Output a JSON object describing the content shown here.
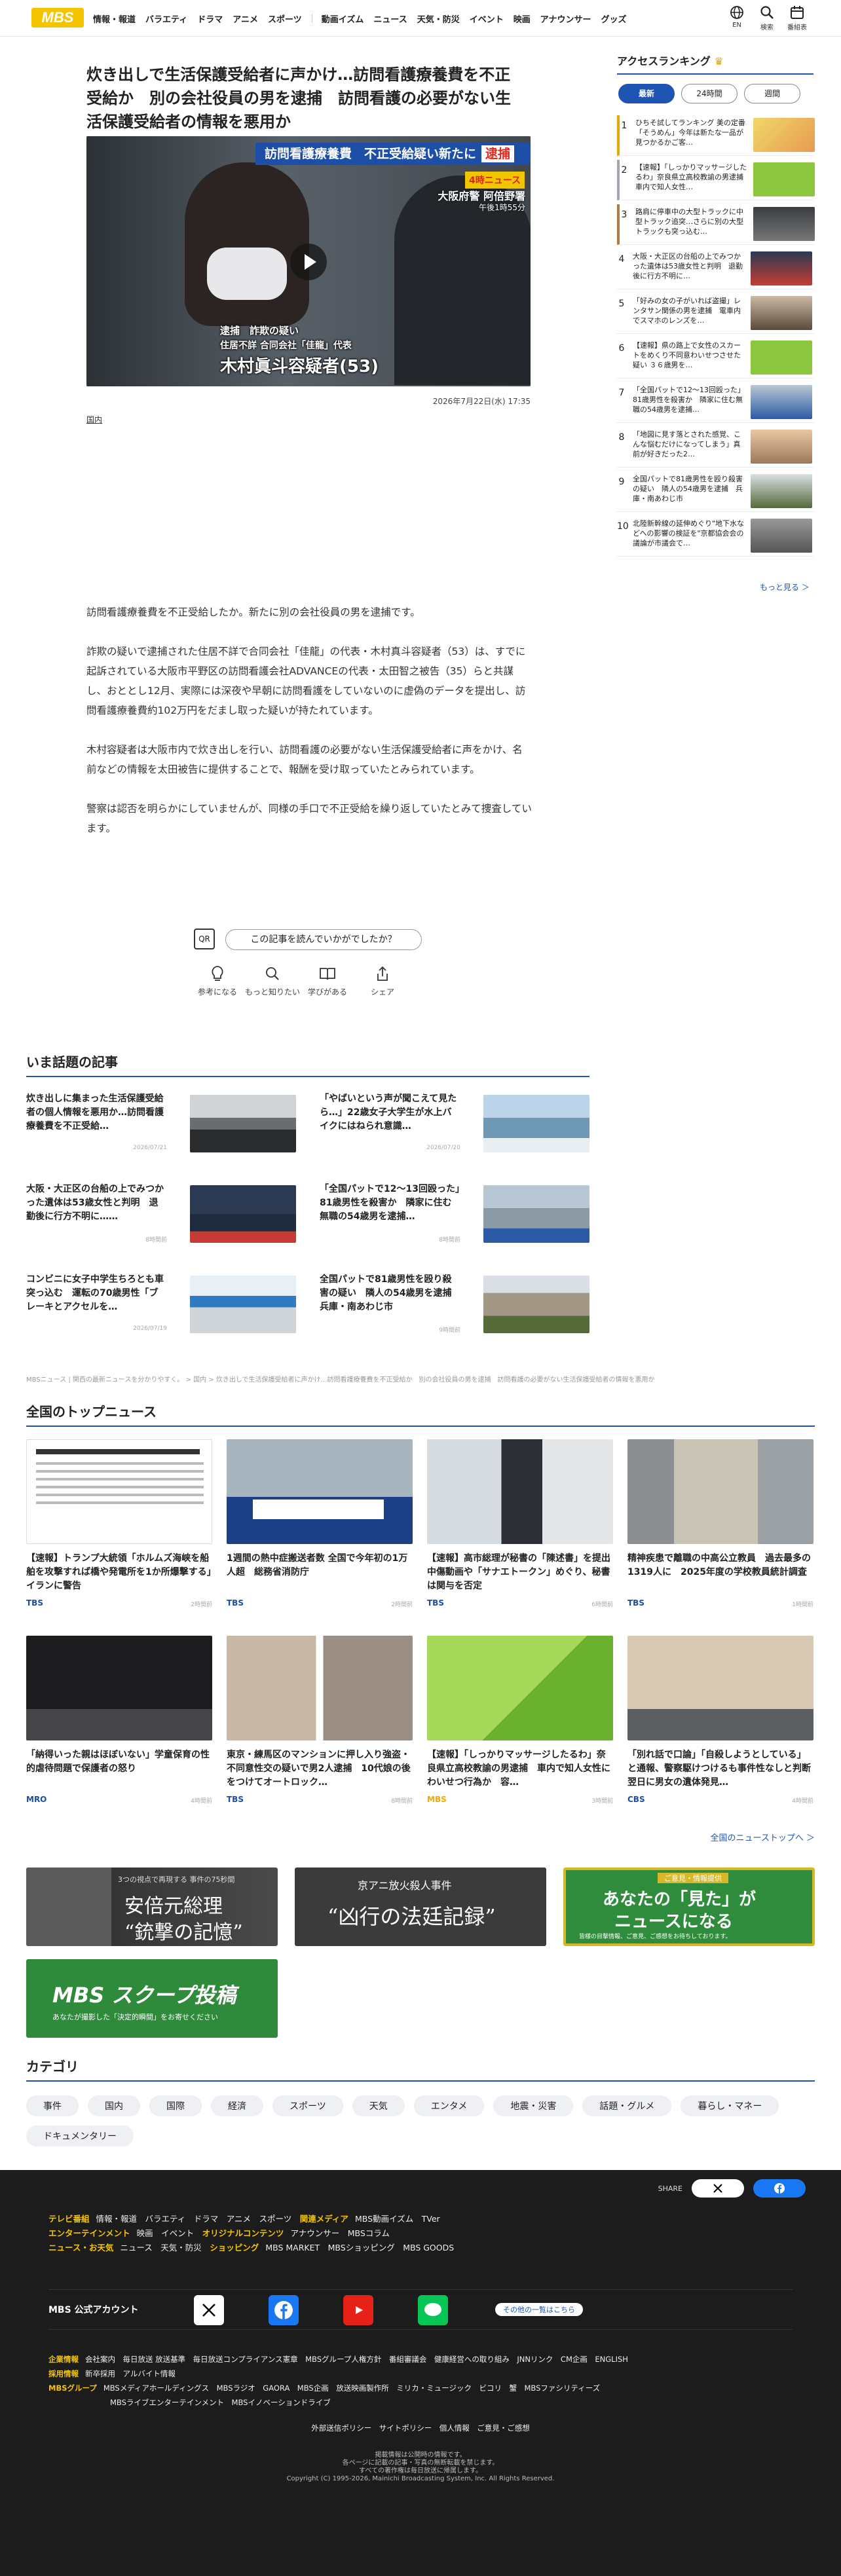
{
  "header": {
    "logo": "MBS",
    "nav": [
      "情報・報道",
      "バラエティ",
      "ドラマ",
      "アニメ",
      "スポーツ",
      "動画イズム",
      "ニュース",
      "天気・防災",
      "イベント",
      "映画",
      "アナウンサー",
      "グッズ"
    ],
    "icons": [
      {
        "icon": "globe-icon",
        "label": "EN"
      },
      {
        "icon": "search-icon",
        "label": "検索"
      },
      {
        "icon": "calendar-icon",
        "label": "番組表"
      }
    ]
  },
  "article": {
    "title": "炊き出しで生活保護受給者に声かけ…訪問看護療養費を不正受給か　別の会社役員の男を逮捕　訪問看護の必要がない生活保護受給者の情報を悪用か",
    "video": {
      "banner_main": "訪問看護療養費",
      "banner_sub": "不正受給疑い新たに",
      "banner_tag": "逮捕",
      "station": "4時ニュース",
      "location": "大阪府警 阿倍野署",
      "location_sub": "午後1時55分",
      "cap1": "逮捕　詐欺の疑い",
      "cap2": "住居不詳 合同会社「佳龍」代表",
      "cap3": "木村眞斗容疑者(53)"
    },
    "date": "2026年7月22日(水) 17:35",
    "category": "国内",
    "paragraphs": [
      "訪問看護療養費を不正受給したか。新たに別の会社役員の男を逮捕です。",
      "詐欺の疑いで逮捕された住居不詳で合同会社「佳龍」の代表・木村真斗容疑者（53）は、すでに起訴されている大阪市平野区の訪問看護会社ADVANCEの代表・太田智之被告（35）らと共謀し、おととし12月、実際には深夜や早朝に訪問看護をしていないのに虚偽のデータを提出し、訪問看護療養費約102万円をだまし取った疑いが持たれています。",
      "木村容疑者は大阪市内で炊き出しを行い、訪問看護の必要がない生活保護受給者に声をかけ、名前などの情報を太田被告に提供することで、報酬を受け取っていたとみられています。",
      "警察は認否を明らかにしていませんが、同様の手口で不正受給を繰り返していたとみて捜査しています。"
    ],
    "survey_label": "この記事を読んでいかがでしたか？",
    "survey_icon": "QR",
    "reactions": [
      {
        "icon": "lightbulb-icon",
        "label": "参考になる"
      },
      {
        "icon": "magnifier-icon",
        "label": "もっと知りたい"
      },
      {
        "icon": "book-icon",
        "label": "学びがある"
      },
      {
        "icon": "share-icon",
        "label": "シェア"
      }
    ]
  },
  "popular": {
    "heading": "いま話題の記事",
    "items": [
      {
        "title": "炊き出しに集まった生活保護受給者の個人情報を悪用か…訪問看護療養費を不正受給…",
        "date": "2026/07/21"
      },
      {
        "title": "「やばいという声が聞こえて見たら…」22歳女子大学生が水上バイクにはねられ意識…",
        "date": "2026/07/20"
      },
      {
        "title": "大阪・大正区の台船の上でみつかった遺体は53歳女性と判明　退勤後に行方不明に……",
        "date": "8時間前"
      },
      {
        "title": "「全国パットで12〜13回殴った」81歳男性を殺害か　隣家に住む無職の54歳男を逮捕…",
        "date": "8時間前"
      },
      {
        "title": "コンビニに女子中学生ちろとも車突っ込む　運転の70歳男性「ブレーキとアクセルを…",
        "date": "2026/07/19"
      },
      {
        "title": "全国パットで81歳男性を殴り殺害の疑い　隣人の54歳男を逮捕　兵庫・南あわじ市",
        "date": "9時間前"
      }
    ]
  },
  "breadcrumb": "MBSニュース | 関西の最新ニュースを分かりやすく。 > 国内 > 炊き出しで生活保護受給者に声かけ…訪問看護療養費を不正受給か　別の会社役員の男を逮捕　訪問看護の必要がない生活保護受給者の情報を悪用か",
  "top_news": {
    "heading": "全国のトップニュース",
    "items": [
      {
        "title": "【速報】トランプ大統領「ホルムズ海峡を船舶を攻撃すれば橋や発電所を1か所爆撃する」イランに警告",
        "source": "TBS",
        "time": "2時間前"
      },
      {
        "title": "1週間の熱中症搬送者数 全国で今年初の1万人超　総務省消防庁",
        "source": "TBS",
        "time": "2時間前"
      },
      {
        "title": "【速報】高市総理が秘書の「陳述書」を提出　中傷動画や「サナエトークン」めぐり、秘書は関与を否定",
        "source": "TBS",
        "time": "6時間前"
      },
      {
        "title": "精神疾患で離職の中高公立教員　過去最多の1319人に　2025年度の学校教員統計調査",
        "source": "TBS",
        "time": "1時間前"
      },
      {
        "title": "「納得いった親はほぼいない」学童保育の性的虐待問題で保護者の怒り",
        "source": "MRO",
        "time": "4時間前"
      },
      {
        "title": "東京・練馬区のマンションに押し入り強盗・不同意性交の疑いで男2人逮捕　10代娘の後をつけてオートロック…",
        "source": "TBS",
        "time": "8時間前"
      },
      {
        "title": "【速報】「しっかりマッサージしたるわ」奈良県立高校教諭の男逮捕　車内で知人女性にわいせつ行為か　容…",
        "source": "MBS",
        "time": "3時間前"
      },
      {
        "title": "「別れ話で口論」「自殺しようとしている」と通報、警察駆けつけるも事件性なしと判断　翌日に男女の遺体発見…",
        "source": "CBS",
        "time": "4時間前"
      }
    ],
    "more": "全国のニューストップへ ＞"
  },
  "banners": [
    {
      "line1": "3つの視点で再現する 事件の75秒間",
      "line2": "安倍元総理",
      "line3": "“銃撃の記憶”"
    },
    {
      "line1": "京アニ放火殺人事件",
      "line2": "“凶行の法廷記録”"
    },
    {
      "line1": "ご意見・情報提供",
      "line2": "あなたの「見た」が",
      "line3": "ニュースになる",
      "line4": "皆様の目撃情報、ご意見、ご感想をお待ちしております。"
    },
    {
      "line1": "MBS スクープ投稿",
      "line2": "あなたが撮影した「決定的瞬間」をお寄せください"
    }
  ],
  "category": {
    "heading": "カテゴリ",
    "items": [
      "事件",
      "国内",
      "国際",
      "経済",
      "スポーツ",
      "天気",
      "エンタメ",
      "地震・災害",
      "話題・グルメ",
      "暮らし・マネー",
      "ドキュメンタリー"
    ]
  },
  "footer": {
    "share_label": "SHARE",
    "rows": [
      {
        "h1": "テレビ番組",
        "t1": "情報・報道　バラエティ　ドラマ　アニメ　スポーツ",
        "h2": "関連メディア",
        "t2": "MBS動画イズム　TVer"
      },
      {
        "h1": "エンターテインメント",
        "t1": "映画　イベント",
        "h2": "オリジナルコンテンツ",
        "t2": "アナウンサー　MBSコラム"
      },
      {
        "h1": "ニュース・お天気",
        "t1": "ニュース　天気・防災",
        "h2": "ショッピング",
        "t2": "MBS MARKET　MBSショッピング　MBS GOODS"
      }
    ],
    "official": "MBS 公式アカウント",
    "official_more": "その他の一覧はこちら",
    "corp": [
      {
        "h": "企業情報",
        "t": "会社案内　毎日放送 放送基準　毎日放送コンプライアンス憲章　MBSグループ人権方針　番組審議会　健康経営への取り組み　JNNリンク　CM企画　ENGLISH"
      },
      {
        "h": "採用情報",
        "t": "新卒採用　アルバイト情報"
      },
      {
        "h": "MBSグループ",
        "t": "MBSメディアホールディングス　MBSラジオ　GAORA　MBS企画　放送映画製作所　ミリカ・ミュージック　ビコリ　蟹　MBSファシリティーズ"
      },
      {
        "h": "",
        "t": "MBSライブエンターテインメント　MBSイノベーションドライブ"
      }
    ],
    "policy": "外部送信ポリシー　サイトポリシー　個人情報　ご意見・ご感想",
    "copy1": "掲載情報は公開時の情報です。",
    "copy2": "各ページに記載の記事・写真の無断転載を禁じます。",
    "copy3": "すべての著作権は毎日放送に帰属します。",
    "copy4": "Copyright (C) 1995-2026, Mainichi Broadcasting System, Inc. All Rights Reserved."
  },
  "sidebar": {
    "heading": "アクセスランキング",
    "tabs": [
      "最新",
      "24時間",
      "週間"
    ],
    "items": [
      {
        "rank": "1",
        "title": "ひちそ試してランキング 美の定番「そうめん」今年は新たな一品が見つかるかご客…"
      },
      {
        "rank": "2",
        "title": "【速報】「しっかりマッサージしたるわ」奈良県立高校教諭の男逮捕　車内で知人女性…"
      },
      {
        "rank": "3",
        "title": "路肩に停車中の大型トラックに中型トラック追突…さらに別の大型トラックも突っ込む…"
      },
      {
        "rank": "4",
        "title": "大阪・大正区の台船の上でみつかった遺体は53歳女性と判明　退勤後に行方不明に…"
      },
      {
        "rank": "5",
        "title": "「好みの女の子がいれば盗撮」レンタサン関係の男を逮捕　電車内でスマホのレンズを…"
      },
      {
        "rank": "6",
        "title": "【速報】県の路上で女性のスカートをめくり不同意わいせつさせた疑い ３６歳男を…"
      },
      {
        "rank": "7",
        "title": "「全国パットで12〜13回殴った」81歳男性を殺害か　隣家に住む無職の54歳男を逮捕…"
      },
      {
        "rank": "8",
        "title": "「地図に見す落とされた感覚、こんな悩むだけになってしまう」真前が好きだった2…"
      },
      {
        "rank": "9",
        "title": "全国パットで81歳男性を殴り殺害の疑い　隣人の54歳男を逮捕　兵庫・南あわじ市"
      },
      {
        "rank": "10",
        "title": "北陸新幹線の延伸めぐり\"地下水などへの影響の検証を\"京都協会会の議論が市議会で…"
      }
    ],
    "more": "もっと見る ＞"
  }
}
